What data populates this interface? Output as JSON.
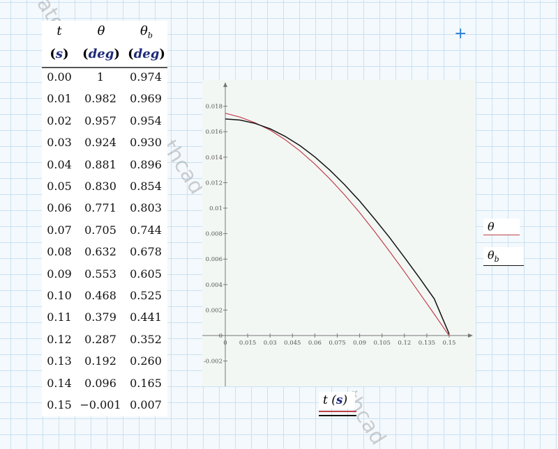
{
  "table": {
    "headers": [
      {
        "sym": "t",
        "sub": ""
      },
      {
        "sym": "θ",
        "sub": ""
      },
      {
        "sym": "θ",
        "sub": "b"
      }
    ],
    "units": [
      "s",
      "deg",
      "deg"
    ],
    "rows": [
      [
        "0.00",
        "1",
        "0.974"
      ],
      [
        "0.01",
        "0.982",
        "0.969"
      ],
      [
        "0.02",
        "0.957",
        "0.954"
      ],
      [
        "0.03",
        "0.924",
        "0.930"
      ],
      [
        "0.04",
        "0.881",
        "0.896"
      ],
      [
        "0.05",
        "0.830",
        "0.854"
      ],
      [
        "0.06",
        "0.771",
        "0.803"
      ],
      [
        "0.07",
        "0.705",
        "0.744"
      ],
      [
        "0.08",
        "0.632",
        "0.678"
      ],
      [
        "0.09",
        "0.553",
        "0.605"
      ],
      [
        "0.10",
        "0.468",
        "0.525"
      ],
      [
        "0.11",
        "0.379",
        "0.441"
      ],
      [
        "0.12",
        "0.287",
        "0.352"
      ],
      [
        "0.13",
        "0.192",
        "0.260"
      ],
      [
        "0.14",
        "0.096",
        "0.165"
      ],
      [
        "0.15",
        "−0.001",
        "0.007"
      ]
    ]
  },
  "chart_data": {
    "type": "line",
    "x": [
      0,
      0.01,
      0.02,
      0.03,
      0.04,
      0.05,
      0.06,
      0.07,
      0.08,
      0.09,
      0.1,
      0.11,
      0.12,
      0.13,
      0.14,
      0.15
    ],
    "series": [
      {
        "name": "θ",
        "color": "#c0404a",
        "values": [
          0.01745,
          0.01714,
          0.0167,
          0.01613,
          0.01538,
          0.01449,
          0.01346,
          0.0123,
          0.01103,
          0.00965,
          0.00817,
          0.00661,
          0.00501,
          0.00335,
          0.00168,
          -2e-05
        ]
      },
      {
        "name": "θb",
        "color": "#111111",
        "values": [
          0.017,
          0.01691,
          0.01665,
          0.01623,
          0.01564,
          0.01491,
          0.01402,
          0.01299,
          0.01183,
          0.01056,
          0.00916,
          0.0077,
          0.00614,
          0.00454,
          0.00288,
          0.00012
        ]
      }
    ],
    "xticks": [
      "0",
      "0.015",
      "0.03",
      "0.045",
      "0.06",
      "0.075",
      "0.09",
      "0.105",
      "0.12",
      "0.135",
      "0.15"
    ],
    "yticks": [
      "-0.002",
      "0",
      "0.002",
      "0.004",
      "0.006",
      "0.008",
      "0.01",
      "0.012",
      "0.014",
      "0.016",
      "0.018"
    ],
    "xlim": [
      0,
      0.15
    ],
    "ylim": [
      -0.002,
      0.018
    ]
  },
  "legend": {
    "theta": "θ",
    "theta_b": "θ",
    "theta_b_sub": "b"
  },
  "xlabel": {
    "var": "t",
    "unit": "s"
  },
  "watermark": [
    "ate",
    "thcad",
    "thcad"
  ]
}
